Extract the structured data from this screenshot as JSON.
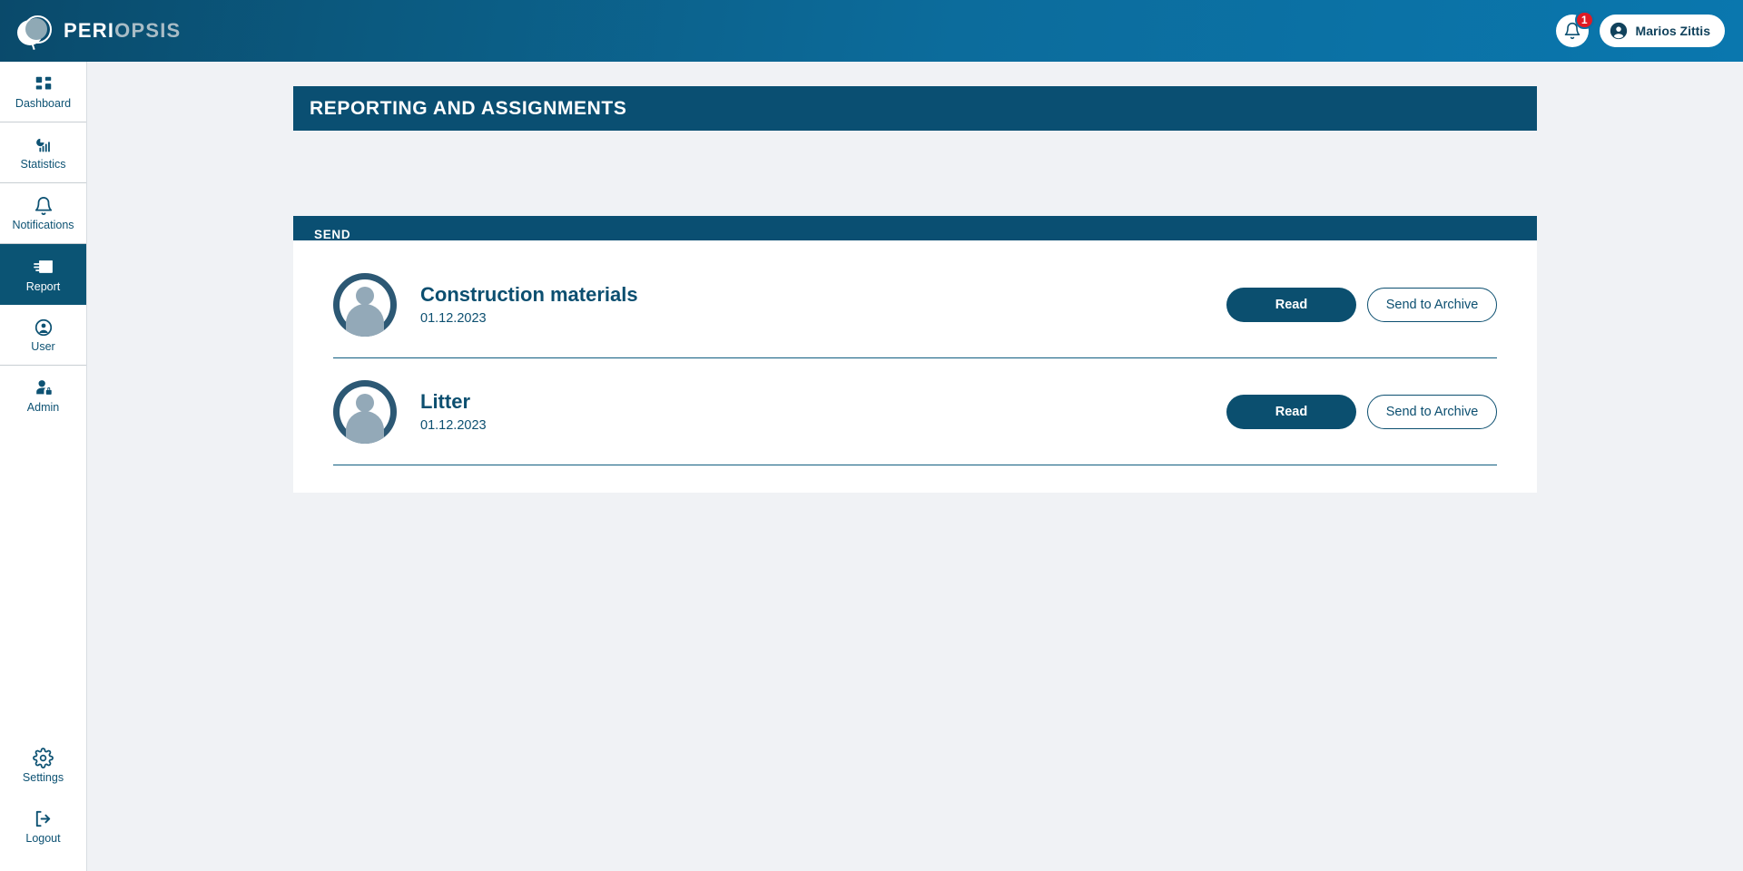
{
  "app": {
    "brand_primary": "PERI",
    "brand_secondary": "OPSIS",
    "logo_icon": "periopsis-circle-logo"
  },
  "topbar": {
    "notifications": {
      "icon": "bell-icon",
      "badge_count": "1"
    },
    "user": {
      "icon": "account-circle-icon",
      "name": "Marios Zittis"
    }
  },
  "sidebar": {
    "items": [
      {
        "label": "Dashboard",
        "icon": "dashboard-grid-icon",
        "active": false
      },
      {
        "label": "Statistics",
        "icon": "chart-bars-icon",
        "active": false
      },
      {
        "label": "Notifications",
        "icon": "bell-icon",
        "active": false
      },
      {
        "label": "Report",
        "icon": "envelope-send-icon",
        "active": true
      },
      {
        "label": "User",
        "icon": "account-circle-icon",
        "active": false
      },
      {
        "label": "Admin",
        "icon": "admin-person-lock-icon",
        "active": false
      }
    ],
    "bottom_items": [
      {
        "label": "Settings",
        "icon": "gear-icon",
        "active": false
      },
      {
        "label": "Logout",
        "icon": "logout-icon",
        "active": false
      }
    ]
  },
  "page": {
    "title": "REPORTING AND ASSIGNMENTS",
    "tabs": [
      {
        "label": "SEND",
        "active": true
      }
    ]
  },
  "reports": {
    "rows": [
      {
        "avatar_icon": "user-avatar-placeholder",
        "title": "Construction materials",
        "date": "01.12.2023",
        "read_label": "Read",
        "archive_label": "Send to Archive"
      },
      {
        "avatar_icon": "user-avatar-placeholder",
        "title": "Litter",
        "date": "01.12.2023",
        "read_label": "Read",
        "archive_label": "Send to Archive"
      }
    ]
  },
  "colors": {
    "brand_dark": "#0a4f72",
    "brand_mid": "#0b6fa4",
    "accent_badge": "#e01b24",
    "page_bg": "#f0f2f5",
    "text_blue": "#0c4f70"
  }
}
